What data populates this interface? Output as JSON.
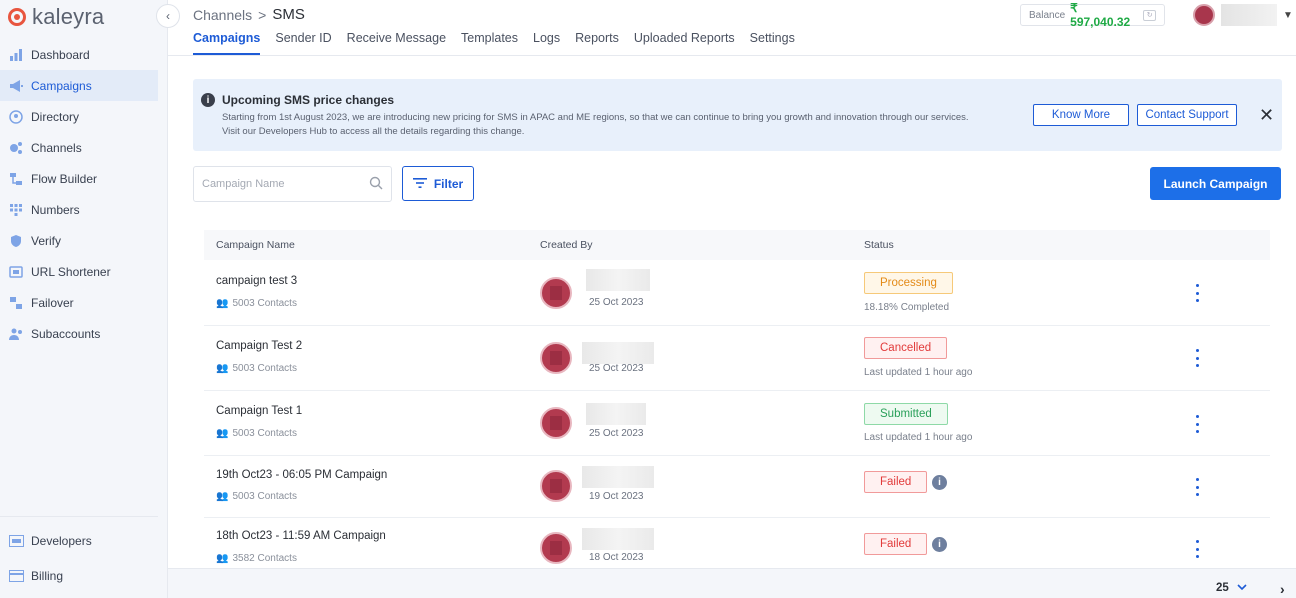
{
  "brand": {
    "name": "kaleyra"
  },
  "sidebar": {
    "items": [
      {
        "label": "Dashboard",
        "icon": "bar-chart-icon"
      },
      {
        "label": "Campaigns",
        "icon": "megaphone-icon",
        "active": true
      },
      {
        "label": "Directory",
        "icon": "contact-icon"
      },
      {
        "label": "Channels",
        "icon": "channels-icon"
      },
      {
        "label": "Flow Builder",
        "icon": "flow-icon"
      },
      {
        "label": "Numbers",
        "icon": "dialpad-icon"
      },
      {
        "label": "Verify",
        "icon": "shield-icon"
      },
      {
        "label": "URL Shortener",
        "icon": "link-icon"
      },
      {
        "label": "Failover",
        "icon": "failover-icon"
      },
      {
        "label": "Subaccounts",
        "icon": "users-icon"
      }
    ],
    "bottom_items": [
      {
        "label": "Developers",
        "icon": "code-icon"
      },
      {
        "label": "Billing",
        "icon": "billing-icon"
      }
    ]
  },
  "header": {
    "breadcrumb": {
      "parent": "Channels",
      "separator": ">",
      "current": "SMS"
    },
    "tabs": [
      "Campaigns",
      "Sender ID",
      "Receive Message",
      "Templates",
      "Logs",
      "Reports",
      "Uploaded Reports",
      "Settings"
    ],
    "active_tab": "Campaigns",
    "balance_label": "Balance",
    "balance_value": "₹ 597,040.32"
  },
  "banner": {
    "title": "Upcoming SMS price changes",
    "line1": "Starting from 1st August 2023, we are introducing new pricing for SMS in APAC and ME regions, so that we can continue to bring you growth and innovation through our services.",
    "line2": "Visit our Developers Hub to access all the details regarding this change.",
    "know_more": "Know More",
    "contact_support": "Contact Support",
    "close": "✕"
  },
  "toolbar": {
    "search_placeholder": "Campaign Name",
    "filter_label": "Filter",
    "launch_label": "Launch Campaign"
  },
  "table": {
    "columns": [
      "Campaign Name",
      "Created By",
      "Status"
    ],
    "rows": [
      {
        "name": "campaign test 3",
        "contacts": "5003 Contacts",
        "date": "25 Oct 2023",
        "status": "Processing",
        "substatus": "18.18% Completed"
      },
      {
        "name": "Campaign Test 2",
        "contacts": "5003 Contacts",
        "date": "25 Oct 2023",
        "status": "Cancelled",
        "substatus": "Last updated 1 hour ago"
      },
      {
        "name": "Campaign Test 1",
        "contacts": "5003 Contacts",
        "date": "25 Oct 2023",
        "status": "Submitted",
        "substatus": "Last updated 1 hour ago"
      },
      {
        "name": "19th Oct23 - 06:05 PM Campaign",
        "contacts": "5003 Contacts",
        "date": "19 Oct 2023",
        "status": "Failed",
        "substatus": ""
      },
      {
        "name": "18th Oct23 - 11:59 AM Campaign",
        "contacts": "3582 Contacts",
        "date": "18 Oct 2023",
        "status": "Failed",
        "substatus": ""
      }
    ]
  },
  "pagination": {
    "per_page": "25"
  },
  "colors": {
    "accent": "#1d5bd6",
    "primary_button": "#1d6fe8",
    "balance": "#1faa45"
  }
}
